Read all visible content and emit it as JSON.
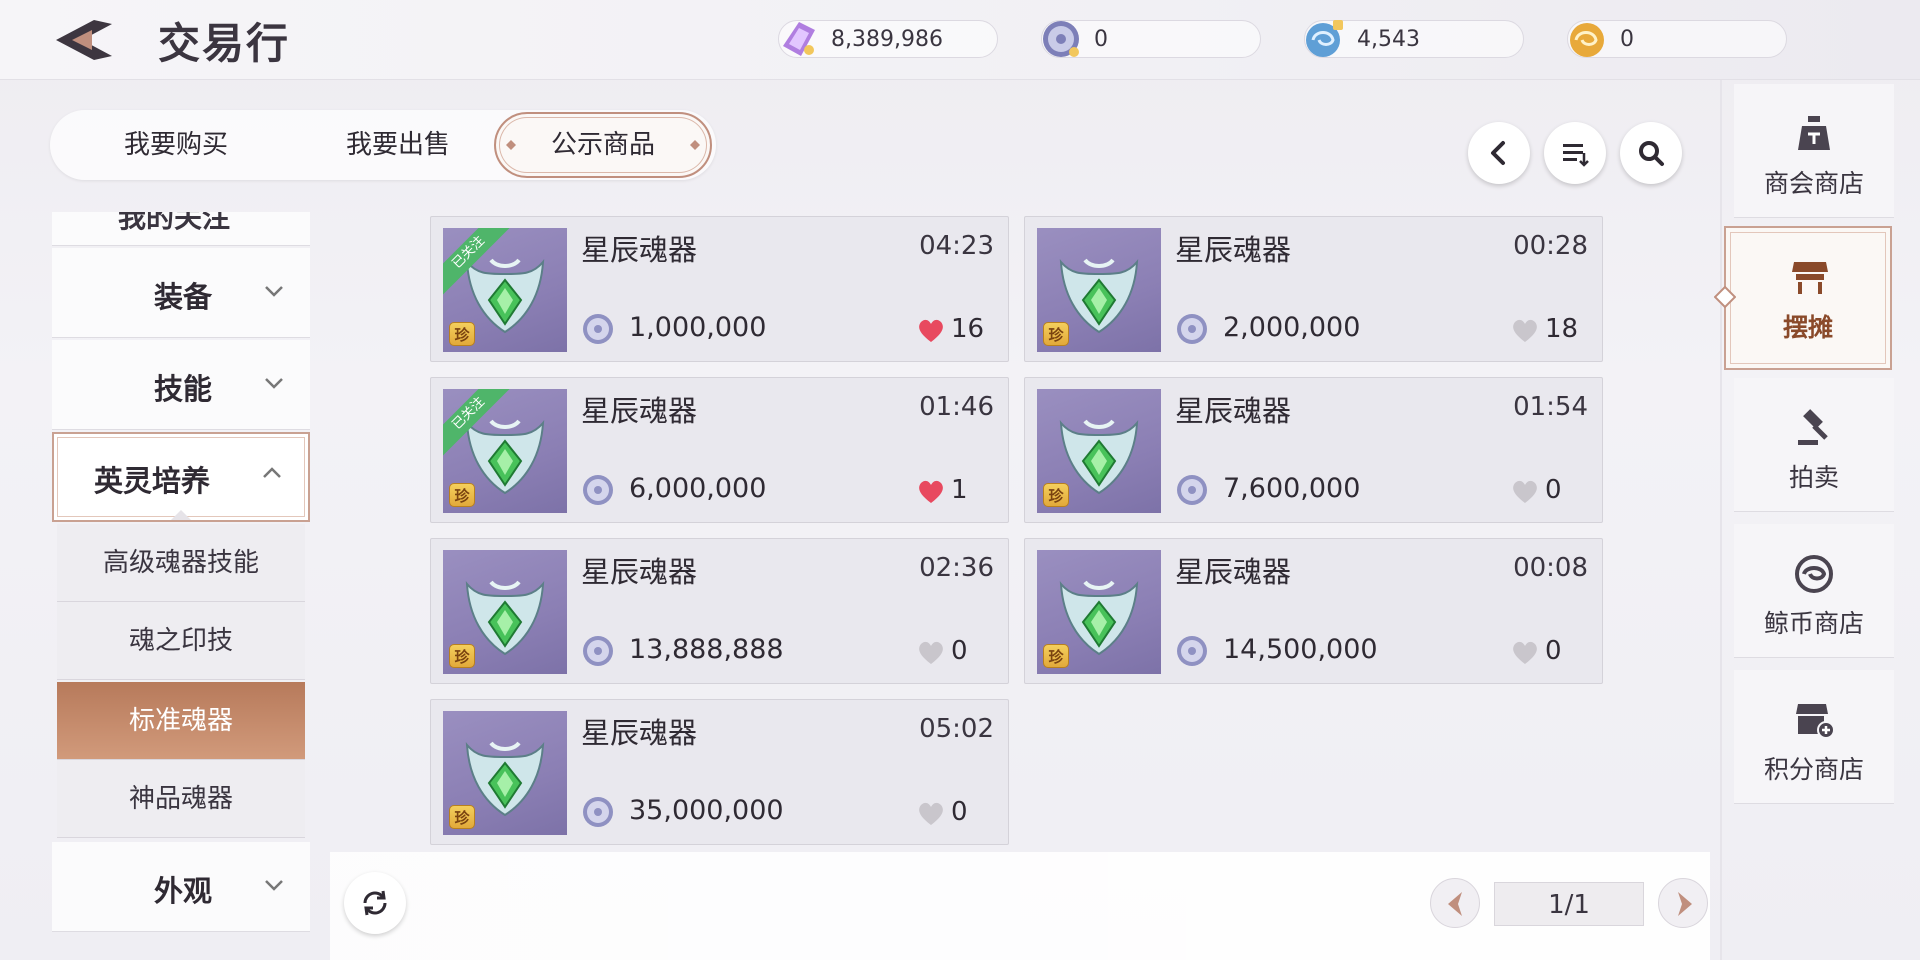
{
  "header": {
    "title": "交易行",
    "currencies": [
      {
        "icon": "crystal-currency-icon",
        "amount": "8,389,986"
      },
      {
        "icon": "silver-coin-currency-icon",
        "amount": "0"
      },
      {
        "icon": "blue-locked-coin-currency-icon",
        "amount": "4,543"
      },
      {
        "icon": "gold-coin-currency-icon",
        "amount": "0"
      }
    ]
  },
  "tabs": [
    {
      "label": "我要购买",
      "active": false
    },
    {
      "label": "我要出售",
      "active": false
    },
    {
      "label": "公示商品",
      "active": true
    }
  ],
  "toolbar": {
    "icons": [
      "chevron-left-icon",
      "sort-list-icon",
      "search-icon"
    ]
  },
  "categories": {
    "cut_off_label": "我的关注",
    "items": [
      {
        "label": "装备",
        "expanded": false
      },
      {
        "label": "技能",
        "expanded": false
      },
      {
        "label": "英灵培养",
        "expanded": true
      },
      {
        "label": "外观",
        "expanded": false
      }
    ],
    "subitems": [
      {
        "label": "高级魂器技能",
        "active": false
      },
      {
        "label": "魂之印技",
        "active": false
      },
      {
        "label": "标准魂器",
        "active": true
      },
      {
        "label": "神品魂器",
        "active": false
      }
    ]
  },
  "listings": [
    {
      "name": "星辰魂器",
      "time": "04:23",
      "price": "1,000,000",
      "likes": "16",
      "liked": true,
      "followed": true,
      "followed_label": "已关注",
      "rare_badge": "珍"
    },
    {
      "name": "星辰魂器",
      "time": "00:28",
      "price": "2,000,000",
      "likes": "18",
      "liked": false,
      "followed": false,
      "rare_badge": "珍"
    },
    {
      "name": "星辰魂器",
      "time": "01:46",
      "price": "6,000,000",
      "likes": "1",
      "liked": true,
      "followed": true,
      "followed_label": "已关注",
      "rare_badge": "珍"
    },
    {
      "name": "星辰魂器",
      "time": "01:54",
      "price": "7,600,000",
      "likes": "0",
      "liked": false,
      "followed": false,
      "rare_badge": "珍"
    },
    {
      "name": "星辰魂器",
      "time": "02:36",
      "price": "13,888,888",
      "likes": "0",
      "liked": false,
      "followed": false,
      "rare_badge": "珍"
    },
    {
      "name": "星辰魂器",
      "time": "00:08",
      "price": "14,500,000",
      "likes": "0",
      "liked": false,
      "followed": false,
      "rare_badge": "珍"
    },
    {
      "name": "星辰魂器",
      "time": "05:02",
      "price": "35,000,000",
      "likes": "0",
      "liked": false,
      "followed": false,
      "rare_badge": "珍"
    }
  ],
  "pagination": {
    "label": "1/1"
  },
  "right_nav": [
    {
      "label": "商会商店",
      "icon": "scale-bag-icon",
      "active": false
    },
    {
      "label": "摆摊",
      "icon": "stall-icon",
      "active": true
    },
    {
      "label": "拍卖",
      "icon": "gavel-icon",
      "active": false
    },
    {
      "label": "鲸币商店",
      "icon": "whale-coin-icon",
      "active": false
    },
    {
      "label": "积分商店",
      "icon": "points-shop-icon",
      "active": false
    }
  ],
  "colors": {
    "accent": "#c08f7e",
    "active_sub": "#c48767",
    "heart_liked": "#e8495f",
    "heart_empty": "#c9c6cc",
    "follow_ribbon": "#4fb56a"
  }
}
